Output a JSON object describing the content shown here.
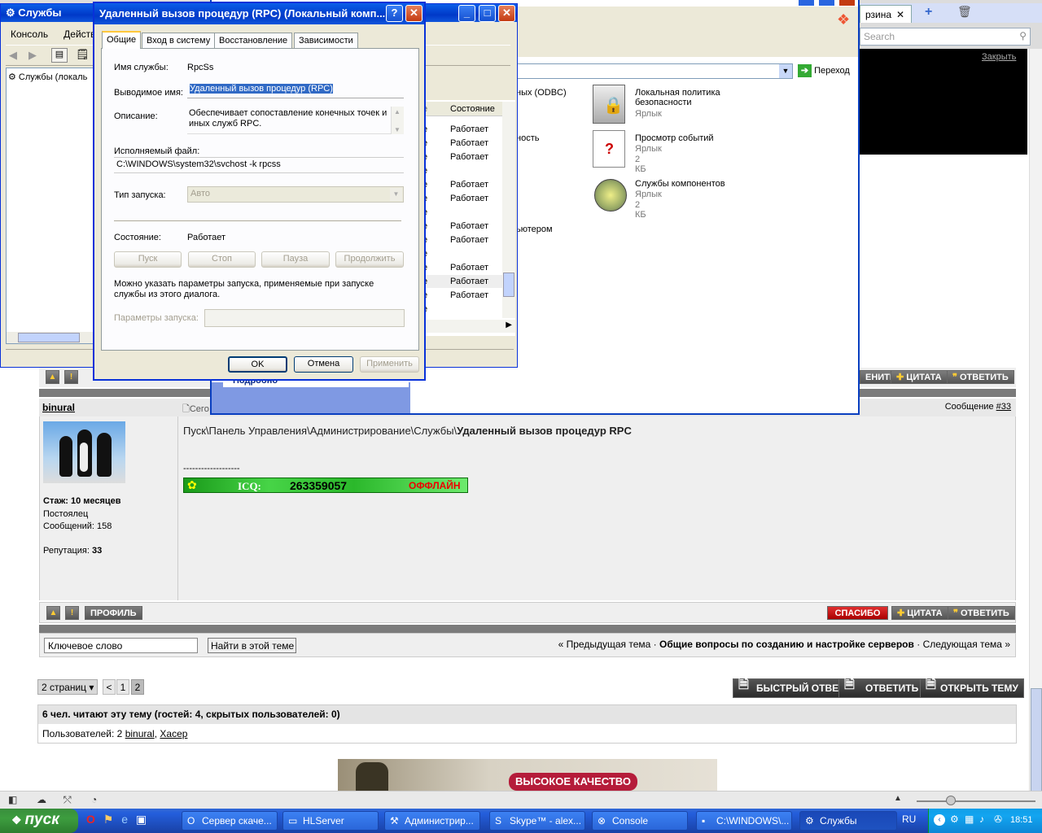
{
  "colors": {
    "xp_blue": "#0a5ee8",
    "forum_grey": "#7b7b7b",
    "icq_green": "#2fc22f",
    "offline_red": "#e00000"
  },
  "browser": {
    "tab_fragment": "рзина",
    "search_placeholder": "Search",
    "close_ad": "Закрыть"
  },
  "forum": {
    "post_top_buttons": [
      "ЕНИТЬ",
      "ЦИТАТА",
      "ОТВЕТИТЬ"
    ],
    "author": "binural",
    "date_fragment": "Сего",
    "message_label": "Сообщение",
    "message_num": "#33",
    "post_text_plain": "Пуск\\Панель Управления\\Администрирование\\Службы\\",
    "post_text_bold": "Удаленный вызов процедур RPC",
    "signature_line": "-------------------",
    "icq_label": "ICQ:",
    "icq_number": "263359057",
    "icq_status": "ОФФЛАЙН",
    "stats": {
      "tenure_label": "Стаж:",
      "tenure": "10 месяцев",
      "rank": "Постоялец",
      "posts": "Сообщений: 158",
      "rep_label": "Репутация:",
      "rep": "33"
    },
    "bottom_buttons": {
      "profile": "ПРОФИЛЬ",
      "thanks": "СПАСИБО",
      "quote": "ЦИТАТА",
      "reply": "ОТВЕТИТЬ"
    },
    "search": {
      "placeholder": "Ключевое слово",
      "button": "Найти в этой теме"
    },
    "nav": {
      "prev": "« Предыдущая тема",
      "sep1": "·",
      "topic": "Общие вопросы по созданию и настройке серверов",
      "sep2": "·",
      "next": "Следующая тема »"
    },
    "pagination": {
      "pages": "2 страниц",
      "prev": "<",
      "p1": "1",
      "p2": "2"
    },
    "actions": {
      "fast_reply": "БЫСТРЫЙ ОТВЕТ",
      "reply": "ОТВЕТИТЬ",
      "new_topic": "ОТКРЫТЬ ТЕМУ"
    },
    "readers": "6 чел. читают эту тему (гостей: 4, скрытых пользователей: 0)",
    "users_label": "Пользователей: 2",
    "user1": "binural",
    "user2": "Xacep",
    "banner": "ВЫСОКОЕ КАЧЕСТВО",
    "zoom_fragment": ""
  },
  "services": {
    "title": "Службы",
    "menu": [
      "Консоль",
      "Действи"
    ],
    "tree_item": "Службы (локаль",
    "status_header": "Состояние",
    "statuses": [
      "Работает",
      "Работает",
      "Работает",
      "",
      "Работает",
      "Работает",
      "",
      "Работает",
      "Работает",
      "",
      "Работает",
      "Работает",
      "Работает",
      ""
    ],
    "sub_panel": "Подробно"
  },
  "admin": {
    "go": "Переход",
    "frag1": "ных (ODBC)",
    "frag2": "ность",
    "frag3": "ьютером",
    "items": [
      {
        "name": "Локальная политика безопасности",
        "type": "Ярлык",
        "size": ""
      },
      {
        "name": "Просмотр событий",
        "type": "Ярлык",
        "size": "2 КБ"
      },
      {
        "name": "Службы компонентов",
        "type": "Ярлык",
        "size": "2 КБ"
      }
    ]
  },
  "dialog": {
    "title": "Удаленный вызов процедур (RPC) (Локальный комп...",
    "tabs": [
      "Общие",
      "Вход в систему",
      "Восстановление",
      "Зависимости"
    ],
    "service_name_label": "Имя службы:",
    "service_name": "RpcSs",
    "display_name_label": "Выводимое имя:",
    "display_name": "Удаленный вызов процедур (RPC)",
    "description_label": "Описание:",
    "description": "Обеспечивает сопоставление конечных точек и иных служб RPC.",
    "exe_label": "Исполняемый файл:",
    "exe_path": "C:\\WINDOWS\\system32\\svchost -k rpcss",
    "startup_label": "Тип запуска:",
    "startup_value": "Авто",
    "state_label": "Состояние:",
    "state_value": "Работает",
    "ctl_buttons": [
      "Пуск",
      "Стоп",
      "Пауза",
      "Продолжить"
    ],
    "hint": "Можно указать параметры запуска, применяемые при запуске службы из этого диалога.",
    "params_label": "Параметры запуска:",
    "ok": "OK",
    "cancel": "Отмена",
    "apply": "Применить"
  },
  "taskbar": {
    "start": "пуск",
    "tasks": [
      "Сервер скаче...",
      "HLServer",
      "Администрир...",
      "Skype™ - alex...",
      "Console",
      "C:\\WINDOWS\\...",
      "Службы"
    ],
    "lang": "RU",
    "clock": "18:51"
  }
}
